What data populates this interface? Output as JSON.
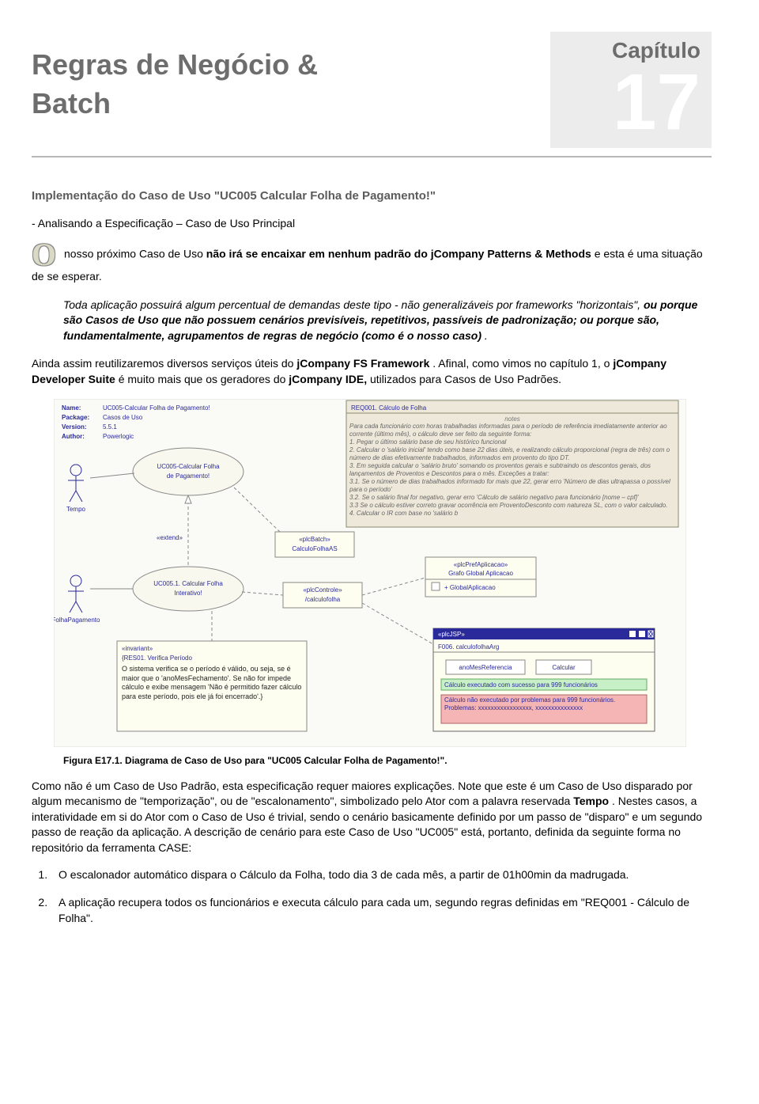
{
  "chapter": {
    "label": "Capítulo",
    "number": "17"
  },
  "title": {
    "line1": "Regras de Negócio &",
    "line2": "Batch"
  },
  "section_heading": "Implementação do Caso de Uso \"UC005 Calcular Folha de Pagamento!\"",
  "sub_heading": "- Analisando a Especificação – Caso de Uso Principal",
  "dropcap": "O",
  "intro_rest": " nosso próximo Caso de Uso ",
  "intro_bold1": "não irá se encaixar em nenhum padrão do jCompany Patterns & Methods",
  "intro_tail": " e esta é uma situação de se esperar.",
  "italic1_a": "Toda aplicação possuirá algum percentual de demandas deste tipo - não generalizáveis por frameworks \"horizontais\", ",
  "italic1_b": "ou porque são Casos de Uso que não possuem cenários previsíveis, repetitivos, passíveis de padronização; ou porque são, fundamentalmente, agrupamentos de regras de negócio (como é o nosso caso)",
  "italic1_c": ".",
  "p2_a": "Ainda assim reutilizaremos diversos serviços úteis do ",
  "p2_b": "jCompany FS Framework",
  "p2_c": ". Afinal, como vimos no capítulo 1, o ",
  "p2_d": "jCompany Developer Suite",
  "p2_e": " é muito mais que os geradores do ",
  "p2_f": "jCompany IDE,",
  "p2_g": " utilizados para Casos de Uso Padrões.",
  "figure": {
    "meta": {
      "name_lbl": "Name:",
      "name_val": "UC005-Calcular Folha de Pagamento!",
      "pkg_lbl": "Package:",
      "pkg_val": "Casos de Uso",
      "ver_lbl": "Version:",
      "ver_val": "5.5.1",
      "auth_lbl": "Author:",
      "auth_val": "Powerlogic"
    },
    "actor1": "Tempo",
    "actor2": "FolhaPagamento",
    "uc_main": "UC005-Calcular Folha de Pagamento!",
    "uc_sub": "UC005.1. Calcular Folha Interativo!",
    "extend": "«extend»",
    "plcBatch_s": "«plcBatch»",
    "plcBatch_v": "CalculoFolhaAS",
    "plcControle_s": "«plcControle»",
    "plcControle_v": "/calculofolha",
    "plcPref_s": "«plcPrefAplicacao»",
    "plcPref_v": "Grafo Global Aplicacao",
    "plcPref_item": "+ GlobalAplicacao",
    "plcJSP_s": "«plcJSP»",
    "plcJSP_v": "F006. calculofolhaArg",
    "btn1": "anoMesReferencia",
    "btn2": "Calcular",
    "msg_ok": "Cálculo executado com sucesso para 999 funcionários",
    "msg_err": "Cálculo não executado por problemas para 999 funcionários. Problemas: xxxxxxxxxxxxxxxxx, xxxxxxxxxxxxxxx",
    "req_title": "REQ001. Cálculo de Folha",
    "req_notes": "notes",
    "req_1": "Para cada funcionário com horas trabalhadas informadas para o período de referência imediatamente anterior ao corrente (último mês), o cálculo deve ser feito da seguinte forma:",
    "req_2": "1. Pegar o último salário base de seu histórico funcional",
    "req_3": "2. Calcular o 'salário inicial' tendo como base 22 dias úteis, e realizando cálculo proporcional (regra de três) com o número de dias efetivamente trabalhados, informados em provento do tipo DT.",
    "req_4": "3. Em seguida calcular o 'salário bruto' somando os proventos gerais e subtraindo os descontos gerais, dos lançamentos de Proventos e Descontos para o mês. Exceções a tratar:",
    "req_5": "3.1. Se o número de dias trabalhados informado for mais que 22, gerar erro 'Número de dias ultrapassa o possível para o período'",
    "req_6": "3.2. Se o salário final for negativo, gerar erro 'Cálculo de salário negativo para funcionário [nome – cpf]'",
    "req_7": "3.3 Se o cálculo estiver correto gravar ocorrência em ProventoDesconto com natureza SL, com o valor calculado.",
    "req_8": "4. Calcular o IR com base no 'salário b",
    "inv_h": "«invariant»",
    "inv_t": "{RES01. Verifica Período",
    "inv_b": "O sistema verifica se o período é válido, ou seja, se é maior que o 'anoMesFechamento'. Se não for impede cálculo e exibe mensagem 'Não é permitido fazer cálculo para este período, pois ele já foi encerrado'.}"
  },
  "figure_caption": "Figura E17.1. Diagrama de Caso de Uso para \"UC005 Calcular Folha de Pagamento!\".",
  "p3_a": "Como não é um Caso de Uso Padrão, esta especificação requer maiores explicações. Note que este é um Caso de Uso disparado por algum mecanismo de \"temporização\", ou de \"escalonamento\", simbolizado pelo Ator com a palavra reservada ",
  "p3_b": "Tempo",
  "p3_c": ". Nestes casos, a interatividade em si do Ator com o Caso de Uso é trivial, sendo o cenário basicamente definido por um passo de \"disparo\" e um segundo passo de reação da aplicação. A descrição de cenário para este Caso de Uso \"UC005\" está, portanto, definida da seguinte forma no repositório da ferramenta CASE:",
  "list": [
    "O escalonador automático dispara o Cálculo da Folha, todo dia 3 de cada mês, a partir de 01h00min da madrugada.",
    "A aplicação recupera todos os funcionários e executa cálculo para cada um, segundo regras definidas em \"REQ001 - Cálculo de Folha\"."
  ]
}
